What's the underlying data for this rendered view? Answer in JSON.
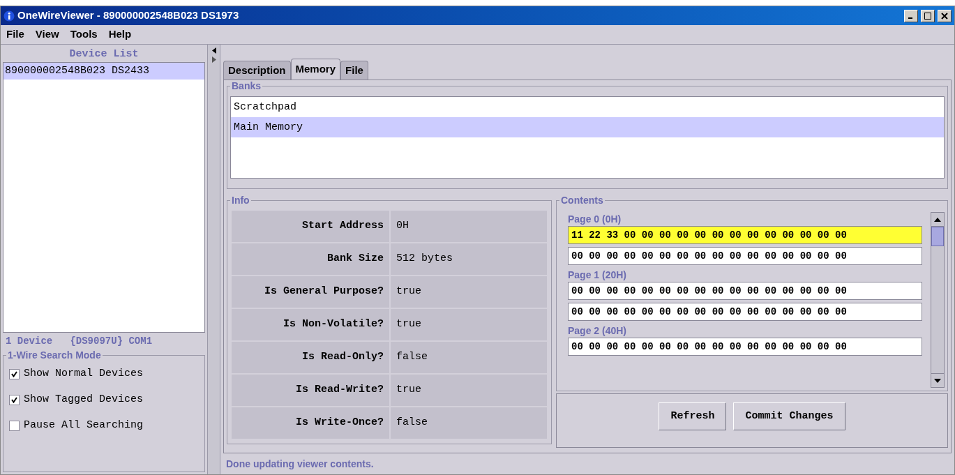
{
  "window": {
    "title": "OneWireViewer - 890000002548B023 DS1973"
  },
  "menu": [
    "File",
    "View",
    "Tools",
    "Help"
  ],
  "device_list": {
    "title": "Device List",
    "items": [
      {
        "label": "890000002548B023 DS2433",
        "selected": true
      }
    ],
    "status": "1 Device   {DS9097U} COM1"
  },
  "search_mode": {
    "title": "1-Wire Search Mode",
    "options": [
      {
        "label": "Show Normal Devices",
        "checked": true
      },
      {
        "label": "Show Tagged Devices",
        "checked": true
      },
      {
        "label": "Pause All Searching",
        "checked": false
      }
    ]
  },
  "tabs": [
    {
      "label": "Description",
      "selected": false
    },
    {
      "label": "Memory",
      "selected": true
    },
    {
      "label": "File",
      "selected": false
    }
  ],
  "banks": {
    "title": "Banks",
    "items": [
      {
        "label": "Scratchpad",
        "selected": false
      },
      {
        "label": "Main Memory",
        "selected": true
      }
    ]
  },
  "info": {
    "title": "Info",
    "rows": [
      {
        "label": "Start Address",
        "value": "0H"
      },
      {
        "label": "Bank Size",
        "value": "512 bytes"
      },
      {
        "label": "Is General Purpose?",
        "value": "true"
      },
      {
        "label": "Is Non-Volatile?",
        "value": "true"
      },
      {
        "label": "Is Read-Only?",
        "value": "false"
      },
      {
        "label": "Is Read-Write?",
        "value": "true"
      },
      {
        "label": "Is Write-Once?",
        "value": "false"
      }
    ]
  },
  "contents": {
    "title": "Contents",
    "pages": [
      {
        "label": "Page 0 (0H)",
        "rows": [
          {
            "text": "11 22 33 00 00 00 00 00 00 00 00 00 00 00 00 00",
            "selected": true
          },
          {
            "text": "00 00 00 00 00 00 00 00 00 00 00 00 00 00 00 00",
            "selected": false
          }
        ]
      },
      {
        "label": "Page 1 (20H)",
        "rows": [
          {
            "text": "00 00 00 00 00 00 00 00 00 00 00 00 00 00 00 00",
            "selected": false
          },
          {
            "text": "00 00 00 00 00 00 00 00 00 00 00 00 00 00 00 00",
            "selected": false
          }
        ]
      },
      {
        "label": "Page 2 (40H)",
        "rows": [
          {
            "text": "00 00 00 00 00 00 00 00 00 00 00 00 00 00 00 00",
            "selected": false
          }
        ]
      }
    ]
  },
  "buttons": [
    "Refresh",
    "Commit Changes"
  ],
  "status_bar": "Done updating viewer contents."
}
